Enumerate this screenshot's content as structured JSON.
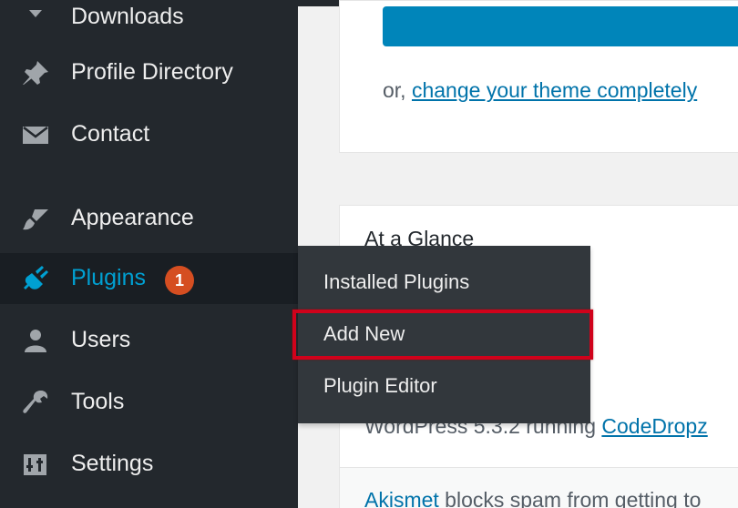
{
  "sidebar": {
    "items": [
      {
        "label": "Downloads",
        "icon": "download-icon"
      },
      {
        "label": "Profile Directory",
        "icon": "pin-icon"
      },
      {
        "label": "Contact",
        "icon": "envelope-icon"
      },
      {
        "label": "Appearance",
        "icon": "paintbrush-icon"
      },
      {
        "label": "Plugins",
        "icon": "plugin-icon",
        "badge": "1",
        "current": true
      },
      {
        "label": "Users",
        "icon": "user-icon"
      },
      {
        "label": "Tools",
        "icon": "wrench-icon"
      },
      {
        "label": "Settings",
        "icon": "settings-icon"
      }
    ]
  },
  "submenu": {
    "items": [
      {
        "label": "Installed Plugins"
      },
      {
        "label": "Add New",
        "highlighted": true
      },
      {
        "label": "Plugin Editor"
      }
    ]
  },
  "welcome": {
    "or_prefix": "or, ",
    "theme_link": "change your theme completely"
  },
  "glance": {
    "title": "At a Glance",
    "wp_prefix": "WordPress 5.3.2 running ",
    "theme_link": "CodeDropz",
    "akismet_link": "Akismet",
    "akismet_text": " blocks spam from getting to"
  },
  "colors": {
    "sidebar_bg": "#23282d",
    "submenu_bg": "#32373c",
    "accent": "#00a0d2",
    "badge": "#d54e21",
    "highlight": "#d0021b",
    "button_blue": "#0085ba",
    "link": "#0073aa"
  }
}
